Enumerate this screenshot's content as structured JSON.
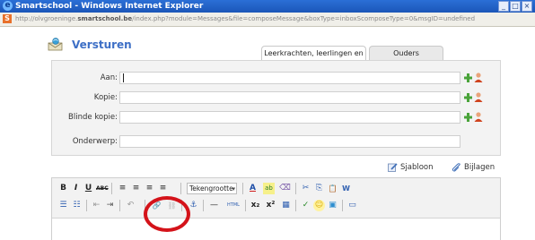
{
  "browser": {
    "window_title": "Smartschool - Windows Internet Explorer",
    "url_prefix": "http://olvgroeninge.",
    "url_domain": "smartschool.be",
    "url_rest": "/index.php?module=Messages&file=composeMessage&boxType=inboxScomposeType=0&msgID=undefined",
    "ie_icon": "ie-e-icon",
    "favicon": "smartschool-s-icon",
    "ie_glyph": "e",
    "favicon_glyph": "S",
    "min_glyph": "_",
    "max_glyph": "□",
    "close_glyph": "×"
  },
  "compose": {
    "heading": "Versturen",
    "tabs": [
      {
        "label": "Leerkrachten, leerlingen en",
        "active": true
      },
      {
        "label": "Ouders",
        "active": false
      }
    ],
    "fields": [
      {
        "label": "Aan:",
        "value": "",
        "has_address_icons": true
      },
      {
        "label": "Kopie:",
        "value": "",
        "has_address_icons": true
      },
      {
        "label": "Blinde kopie:",
        "value": "",
        "has_address_icons": true
      },
      {
        "label": "Onderwerp:",
        "value": "",
        "has_address_icons": false
      }
    ],
    "template_label": "Sjabloon",
    "attachments_label": "Bijlagen"
  },
  "editor": {
    "font_size_select": "Tekengrootte",
    "toolbar_row1": [
      {
        "name": "bold-icon",
        "glyph": "B"
      },
      {
        "name": "italic-icon",
        "glyph": "I"
      },
      {
        "name": "underline-icon",
        "glyph": "U"
      },
      {
        "name": "strikethrough-icon",
        "glyph": "ABC"
      },
      {
        "name": "align-left-icon",
        "glyph": "≡"
      },
      {
        "name": "align-center-icon",
        "glyph": "≡"
      },
      {
        "name": "align-right-icon",
        "glyph": "≡"
      },
      {
        "name": "align-justify-icon",
        "glyph": "≡"
      },
      {
        "name": "font-color-icon",
        "glyph": "A"
      },
      {
        "name": "highlight-color-icon",
        "glyph": "ab"
      },
      {
        "name": "clear-format-icon",
        "glyph": "⌫"
      },
      {
        "name": "cut-icon",
        "glyph": "✂"
      },
      {
        "name": "copy-icon",
        "glyph": "⎘"
      },
      {
        "name": "paste-icon",
        "glyph": "📋"
      },
      {
        "name": "paste-word-icon",
        "glyph": "W"
      }
    ],
    "toolbar_row2": [
      {
        "name": "bullet-list-icon",
        "glyph": "☰"
      },
      {
        "name": "numbered-list-icon",
        "glyph": "☷"
      },
      {
        "name": "outdent-icon",
        "glyph": "⇤"
      },
      {
        "name": "indent-icon",
        "glyph": "⇥"
      },
      {
        "name": "undo-icon",
        "glyph": "↶"
      },
      {
        "name": "insert-link-icon",
        "glyph": "🔗"
      },
      {
        "name": "unlink-icon",
        "glyph": "⛓"
      },
      {
        "name": "anchor-icon",
        "glyph": "⚓"
      },
      {
        "name": "horizontal-rule-icon",
        "glyph": "—"
      },
      {
        "name": "html-source-icon",
        "glyph": "HTML"
      },
      {
        "name": "subscript-icon",
        "glyph": "x₂"
      },
      {
        "name": "superscript-icon",
        "glyph": "x²"
      },
      {
        "name": "insert-table-icon",
        "glyph": "▦"
      },
      {
        "name": "spellcheck-icon",
        "glyph": "✓"
      },
      {
        "name": "emoticon-icon",
        "glyph": "☺"
      },
      {
        "name": "insert-image-icon",
        "glyph": "▣"
      },
      {
        "name": "media-icon",
        "glyph": "▭"
      }
    ],
    "highlighted_button": "insert-link-icon"
  },
  "colors": {
    "titlebar": "#1b56b8",
    "heading": "#3d6fc6",
    "highlight_ring": "#d4131a",
    "add_icon": "#4aa33a",
    "person_icon": "#d0431e"
  }
}
